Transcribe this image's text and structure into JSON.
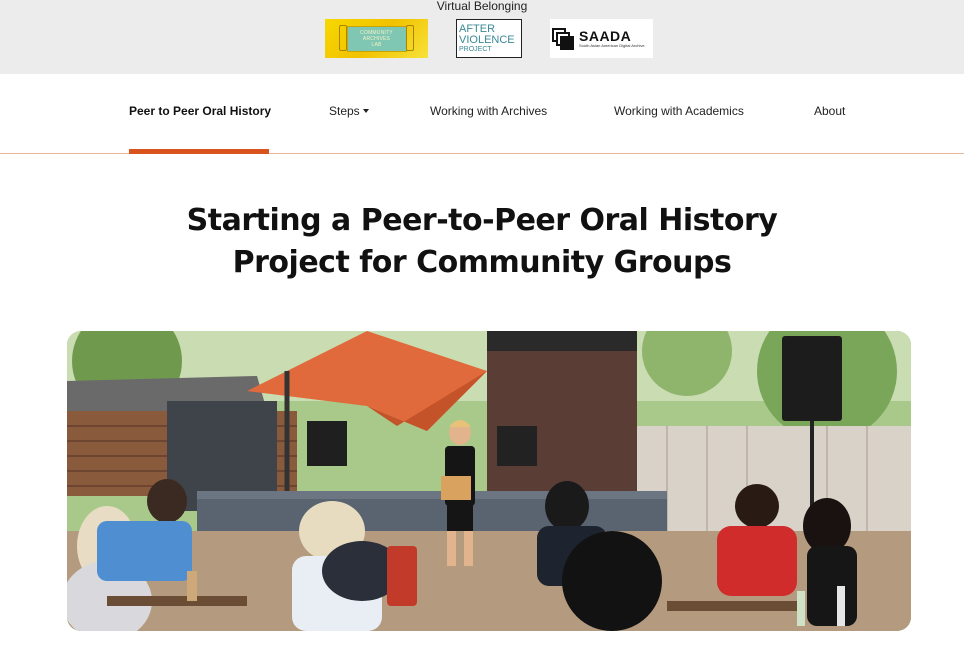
{
  "partners": {
    "heading": "Virtual Belonging",
    "logos": [
      {
        "name": "community-archives-lab",
        "lines": [
          "COMMUNITY",
          "ARCHIVES",
          "LAB"
        ]
      },
      {
        "name": "after-violence-project",
        "lines": [
          "AFTER",
          "VIOLENCE",
          "PROJECT"
        ]
      },
      {
        "name": "saada",
        "title": "SAADA",
        "subtitle": "South Asian American Digital Archive"
      }
    ]
  },
  "nav": {
    "items": [
      {
        "label": "Peer to Peer Oral History",
        "active": true
      },
      {
        "label": "Steps",
        "has_dropdown": true
      },
      {
        "label": "Working with Archives"
      },
      {
        "label": "Working with Academics"
      },
      {
        "label": "About"
      }
    ]
  },
  "page": {
    "title_line1": "Starting a Peer-to-Peer Oral History",
    "title_line2": "Project for Community Groups"
  },
  "colors": {
    "accent": "#d9531e",
    "nav_border": "#e9b89c",
    "banner_bg": "#ececec"
  }
}
